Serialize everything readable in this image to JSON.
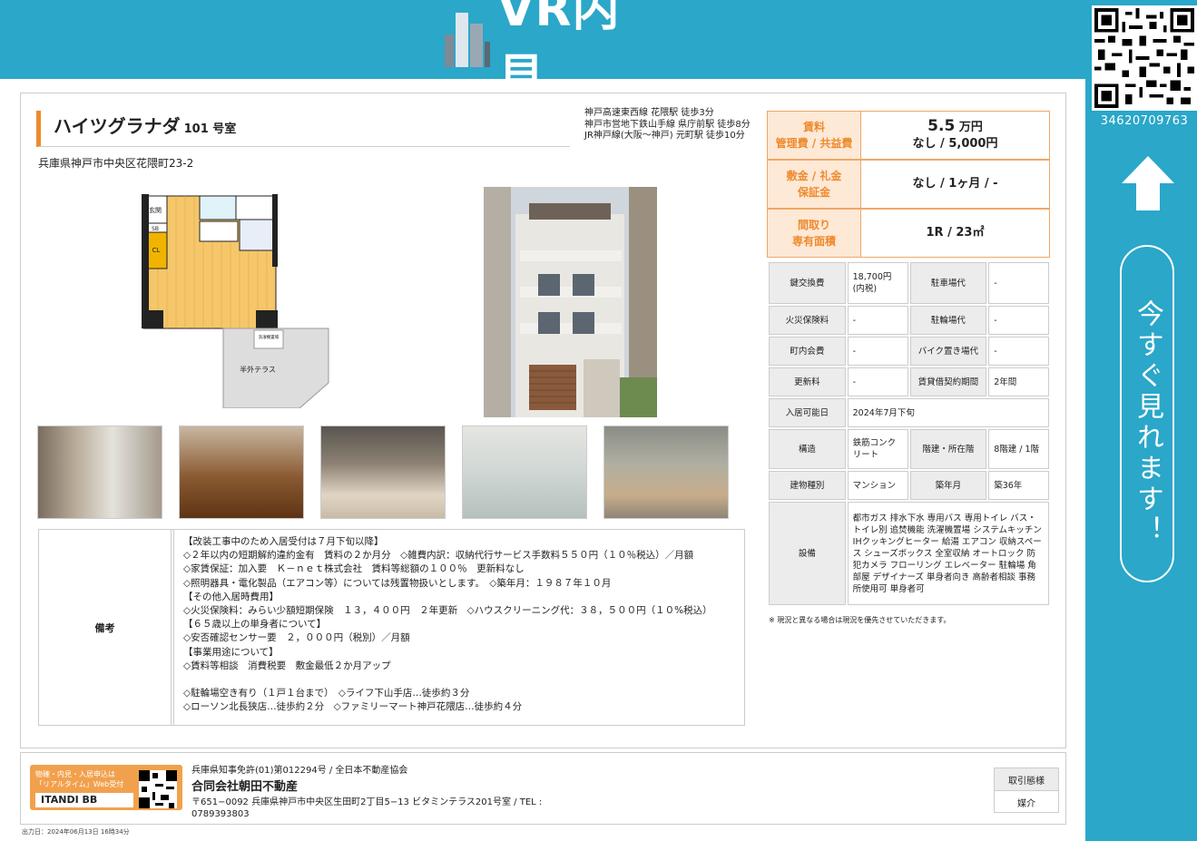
{
  "header": {
    "logo_text": "VR内見"
  },
  "side": {
    "qr_number": "34620709763",
    "cta": "今すぐ見れます！"
  },
  "property": {
    "name": "ハイツグラナダ",
    "room": "101 号室",
    "address": "兵庫県神戸市中央区花隈町23-2",
    "stations": [
      "神戸高速東西線 花隈駅 徒歩3分",
      "神戸市営地下鉄山手線 県庁前駅 徒歩8分",
      "JR神戸線(大阪〜神戸) 元町駅 徒歩10分"
    ]
  },
  "floorplan": {
    "labels": {
      "genkan": "玄関",
      "sb": "SB",
      "cl": "CL",
      "sentaku": "洗濯機置場",
      "terrace": "半外テラス"
    }
  },
  "rent": {
    "rent_label": "賃料",
    "fee_label": "管理費 / 共益費",
    "rent_value": "5.5",
    "rent_unit": "万円",
    "fee_value": "なし / 5,000円",
    "deposit_label": "敷金 / 礼金",
    "guarantee_label": "保証金",
    "deposit_value": "なし / 1ヶ月 / -",
    "layout_label": "間取り",
    "area_label": "専有面積",
    "layout_value": "1R / 23㎡"
  },
  "spec": {
    "key_exchange_label": "鍵交換費",
    "key_exchange": "18,700円(内税)",
    "parking_label": "駐車場代",
    "parking": "-",
    "fire_ins_label": "火災保険料",
    "fire_ins": "-",
    "bicycle_label": "駐輪場代",
    "bicycle": "-",
    "town_fee_label": "町内会費",
    "town_fee": "-",
    "bike_label": "バイク置き場代",
    "bike": "-",
    "renewal_label": "更新料",
    "renewal": "-",
    "period_label": "賃貸借契約期間",
    "period": "2年間",
    "move_in_label": "入居可能日",
    "move_in": "2024年7月下旬",
    "structure_label": "構造",
    "structure": "鉄筋コンクリート",
    "floor_label": "階建・所在階",
    "floor": "8階建 / 1階",
    "type_label": "建物種別",
    "type": "マンション",
    "age_label": "築年月",
    "age": "築36年",
    "equip_label": "設備",
    "equip": "都市ガス 排水下水 専用バス 専用トイレ バス・トイレ別 追焚機能 洗濯機置場 システムキッチン IHクッキングヒーター 給湯 エアコン 収納スペース シューズボックス 全室収納 オートロック 防犯カメラ フローリング エレベーター 駐輪場 角部屋 デザイナーズ 単身者向き 高齢者相談 事務所使用可 単身者可"
  },
  "note": "※ 現況と異なる場合は現況を優先させていただきます。",
  "remarks": {
    "label": "備考",
    "text": "【改装工事中のため入居受付は７月下旬以降】\n◇２年以内の短期解約違約金有　賃料の２か月分　◇雑費内訳：収納代行サービス手数料５５０円（１０％税込）／月額\n◇家賃保証：加入要　Ｋ－ｎｅｔ株式会社　賃料等総額の１００％　更新料なし\n◇照明器具・電化製品（エアコン等）については残置物扱いとします。　◇築年月：１９８７年１０月\n【その他入居時費用】\n◇火災保険料：みらい少額短期保険　１３，４００円　２年更新　◇ハウスクリーニング代：３８，５００円（１０%税込）\n【６５歳以上の単身者について】\n◇安否確認センサー要　２，０００円（税別）／月額\n【事業用途について】\n◇賃料等相談　消費税要　敷金最低２か月アップ\n\n◇駐輪場空き有り（１戸１台まで）　◇ライフ下山手店…徒歩約３分\n◇ローソン北長狭店…徒歩約２分　◇ファミリーマート神戸花隈店…徒歩約４分"
  },
  "footer": {
    "banner_text": "物確・内見・入居申込は\n「リアルタイム」Web受付",
    "banner_brand": "ITANDI BB",
    "license": "兵庫県知事免許(01)第012294号 / 全日本不動産協会",
    "company": "合同会社朝田不動産",
    "address": "〒651−0092 兵庫県神戸市中央区生田町2丁目5−13 ビタミンテラス201号室 / TEL : 0789393803",
    "deal_label": "取引態様",
    "deal_value": "媒介",
    "printed": "出力日：2024年06月13日 16時34分"
  }
}
